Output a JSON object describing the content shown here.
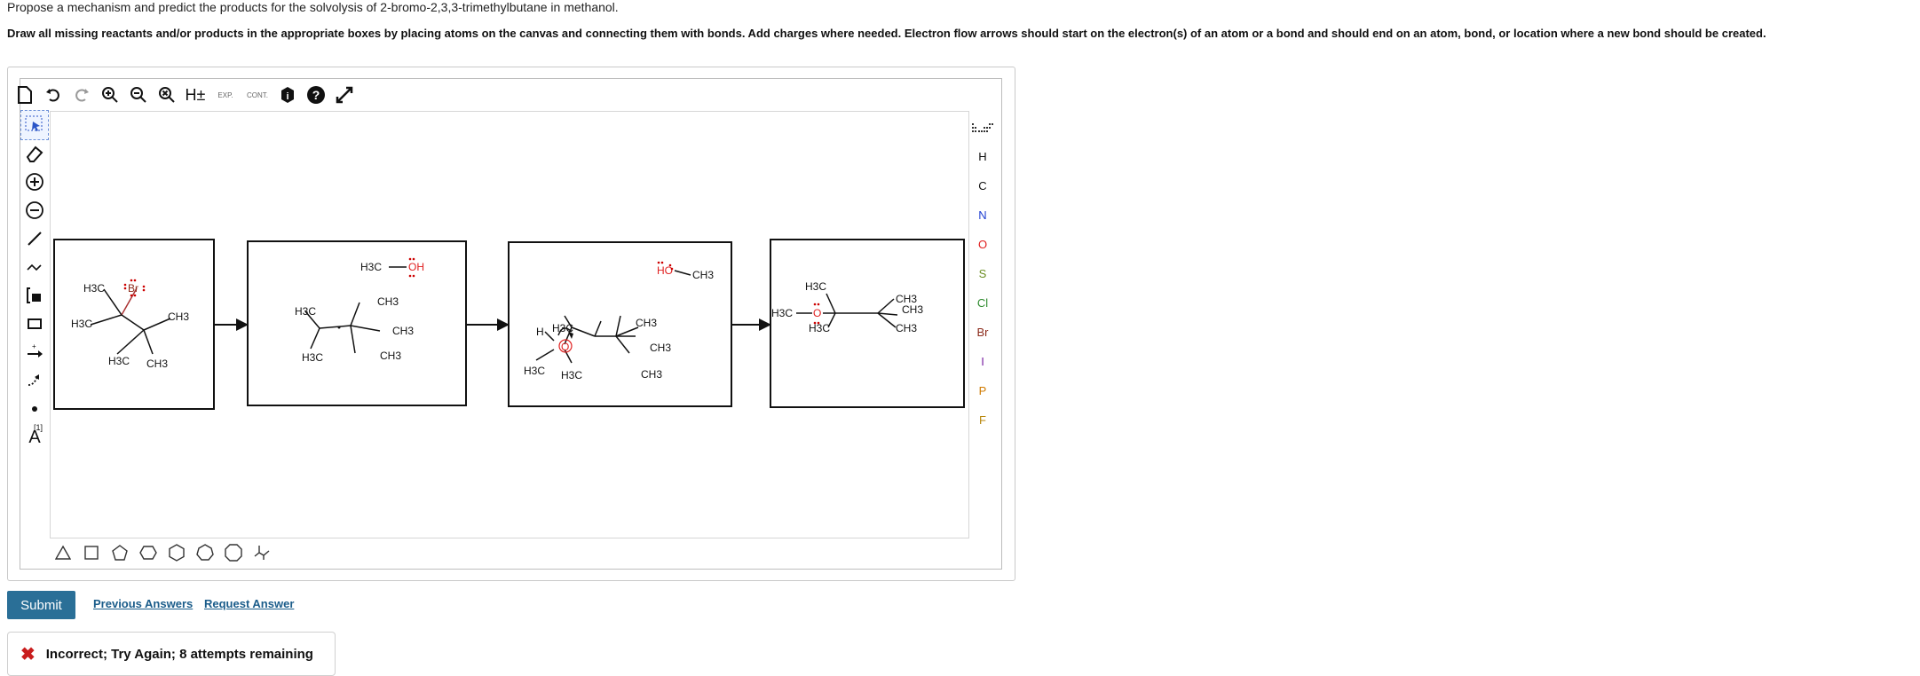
{
  "question": {
    "line1": "Propose a mechanism and predict the products for the solvolysis of 2-bromo-2,3,3-trimethylbutane in methanol.",
    "line2": "Draw all missing reactants and/or products in the appropriate boxes by placing atoms on the canvas and connecting them with bonds. Add charges where needed. Electron flow arrows should start on the electron(s) of an atom or a bond and should end on an atom, bond, or location where a new bond should be created."
  },
  "toolbar_top": {
    "h_toggle": "H±",
    "exp_label": "EXP.",
    "cont_label": "CONT."
  },
  "toolbar_left": {
    "charge_label": "[1]",
    "text_tool": "A"
  },
  "atoms": [
    "H",
    "C",
    "N",
    "O",
    "S",
    "Cl",
    "Br",
    "I",
    "P",
    "F"
  ],
  "atom_colors": {
    "H": "#111111",
    "C": "#111111",
    "N": "#1f3fd1",
    "O": "#e02020",
    "S": "#6b8e23",
    "Cl": "#2e8b2e",
    "Br": "#8b2a1a",
    "I": "#7a1fa2",
    "P": "#d07a00",
    "F": "#b8860b"
  },
  "molecules": {
    "m1": {
      "h3c_top": "H3C",
      "br": "Br",
      "h3c_left": "H3C",
      "ch3_right": "CH3",
      "h3c_bl": "H3C",
      "ch3_bm": "CH3"
    },
    "m2": {
      "methanol_h3c": "H3C",
      "methanol_oh": "OH",
      "h3c": "H3C",
      "ch3_top": "CH3",
      "ch3_mid": "CH3",
      "h3c_bot": "H3C",
      "ch3_bot": "CH3"
    },
    "m3": {
      "ho": "HO",
      "ch3_methanol": "CH3",
      "h": "H",
      "h3c_top": "H3C",
      "ch3_right": "CH3",
      "ch3_mid": "CH3",
      "h3c_left": "H3C",
      "h3c_low": "H3C",
      "ch3_bot": "CH3",
      "o": "O"
    },
    "m4": {
      "h3c_top": "H3C",
      "h3c_o": "H3C",
      "o": "O",
      "ch3_a": "CH3",
      "ch3_b": "CH3",
      "h3c_bot": "H3C",
      "ch3_bot": "CH3"
    }
  },
  "actions": {
    "submit": "Submit",
    "previous_answers": "Previous Answers",
    "request_answer": "Request Answer"
  },
  "feedback": {
    "icon": "✖",
    "text": "Incorrect; Try Again; 8 attempts remaining"
  }
}
